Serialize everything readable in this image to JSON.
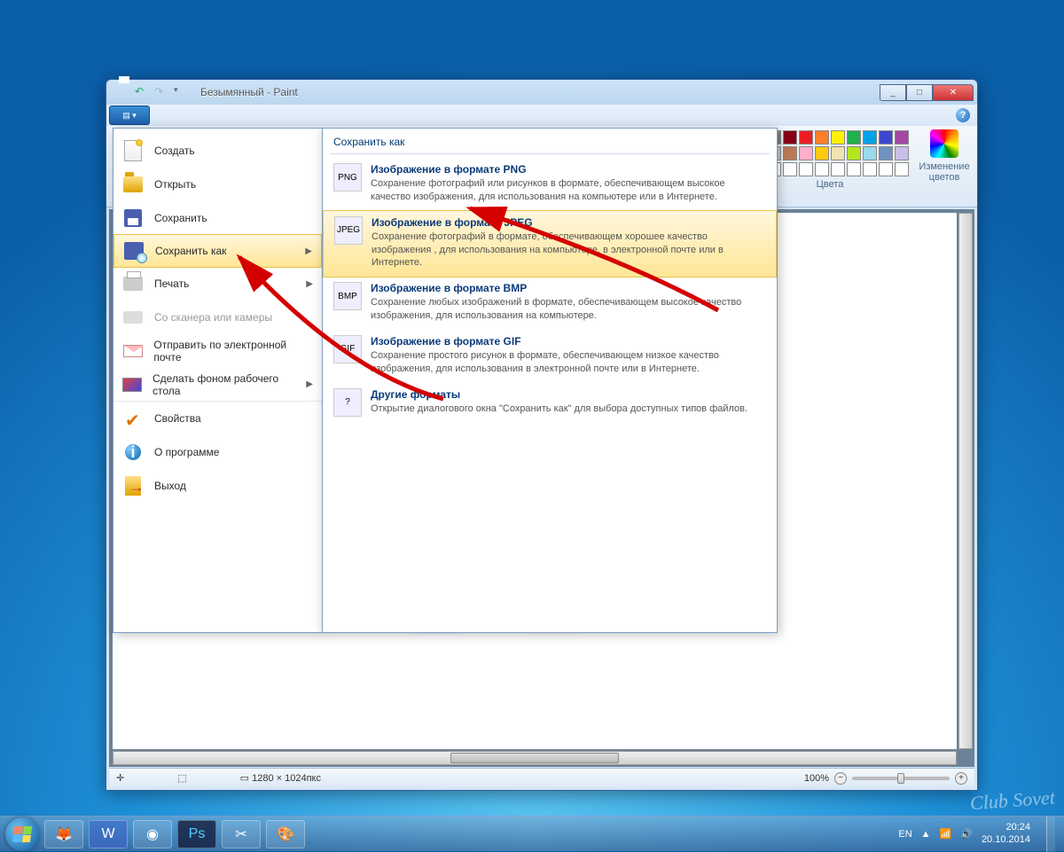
{
  "window": {
    "title": "Безымянный - Paint",
    "controls": {
      "minimize": "_",
      "maximize": "□",
      "close": "✕"
    }
  },
  "ribbon": {
    "file_tab_label": "▾",
    "help_tooltip": "?",
    "colors_label": "Цвета",
    "edit_colors_label": "Изменение цветов",
    "palette_row1": [
      "#000000",
      "#7f7f7f",
      "#880015",
      "#ed1c24",
      "#ff7f27",
      "#fff200",
      "#22b14c",
      "#00a2e8",
      "#3f48cc",
      "#a349a4"
    ],
    "palette_row2": [
      "#ffffff",
      "#c3c3c3",
      "#b97a57",
      "#ffaec9",
      "#ffc90e",
      "#efe4b0",
      "#b5e61d",
      "#99d9ea",
      "#7092be",
      "#c8bfe7"
    ],
    "palette_row3": [
      "#ffffff",
      "#ffffff",
      "#ffffff",
      "#ffffff",
      "#ffffff",
      "#ffffff",
      "#ffffff",
      "#ffffff",
      "#ffffff",
      "#ffffff"
    ]
  },
  "file_menu": {
    "items": [
      {
        "label": "Создать",
        "icon": "new"
      },
      {
        "label": "Открыть",
        "icon": "open"
      },
      {
        "label": "Сохранить",
        "icon": "save"
      },
      {
        "label": "Сохранить как",
        "icon": "saveas",
        "submenu": true,
        "highlighted": true
      },
      {
        "label": "Печать",
        "icon": "print",
        "submenu": true
      },
      {
        "label": "Со сканера или камеры",
        "icon": "scan",
        "disabled": true
      },
      {
        "label": "Отправить по электронной почте",
        "icon": "mail"
      },
      {
        "label": "Сделать фоном рабочего стола",
        "icon": "desktop",
        "submenu": true
      },
      {
        "label": "Свойства",
        "icon": "props"
      },
      {
        "label": "О программе",
        "icon": "about"
      },
      {
        "label": "Выход",
        "icon": "exit"
      }
    ]
  },
  "submenu": {
    "title": "Сохранить как",
    "items": [
      {
        "title": "Изображение в формате PNG",
        "desc": "Сохранение фотографий или рисунков в формате, обеспечивающем высокое качество изображения, для использования на компьютере или в Интернете.",
        "icon": "PNG"
      },
      {
        "title": "Изображение в формате JPEG",
        "desc": "Сохранение фотографий в формате, обеспечивающем хорошее качество изображения , для использования на компьютере, в электронной почте или в Интернете.",
        "icon": "JPEG",
        "highlighted": true
      },
      {
        "title": "Изображение в формате BMP",
        "desc": "Сохранение любых изображений в формате, обеспечивающем высокое качество изображения, для использования на компьютере.",
        "icon": "BMP"
      },
      {
        "title": "Изображение в формате GIF",
        "desc": "Сохранение простого рисунок в формате, обеспечивающем низкое качество изображения, для использования в электронной почте или в Интернете.",
        "icon": "GIF"
      },
      {
        "title": "Другие форматы",
        "desc": "Открытие диалогового окна \"Сохранить как\" для выбора доступных типов файлов.",
        "icon": "?"
      }
    ]
  },
  "statusbar": {
    "cursor_icon": "✛",
    "selection_icon": "⬚",
    "dimensions_icon": "▭",
    "dimensions": "1280 × 1024пкс",
    "zoom_label": "100%",
    "zoom_minus": "−",
    "zoom_plus": "+"
  },
  "taskbar": {
    "tray_lang": "EN",
    "tray_time": "20:24",
    "tray_date": "20.10.2014"
  },
  "watermark": "Club Sovet"
}
